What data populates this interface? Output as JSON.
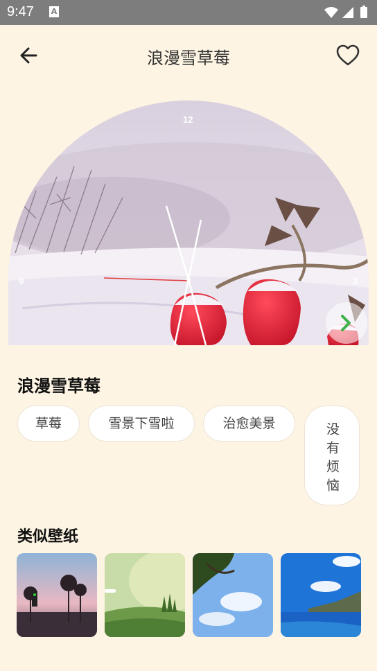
{
  "status_bar": {
    "time": "9:47",
    "notification_icon": "A"
  },
  "header": {
    "title": "浪漫雪草莓",
    "back_icon": "arrow-left-icon",
    "favorite_icon": "heart-outline-icon"
  },
  "preview": {
    "clock": {
      "twelve": "12",
      "nine": "9",
      "three": "3"
    },
    "next_icon": "chevron-right-icon",
    "accent": "#3bb34a"
  },
  "wallpaper": {
    "title": "浪漫雪草莓",
    "tags": [
      "草莓",
      "雪景下雪啦",
      "治愈美景",
      "没有烦恼"
    ]
  },
  "similar": {
    "title": "类似壁纸",
    "items": [
      "street-palms-thumbnail",
      "green-hills-thumbnail",
      "blue-sky-tree-thumbnail",
      "coast-thumbnail"
    ]
  }
}
